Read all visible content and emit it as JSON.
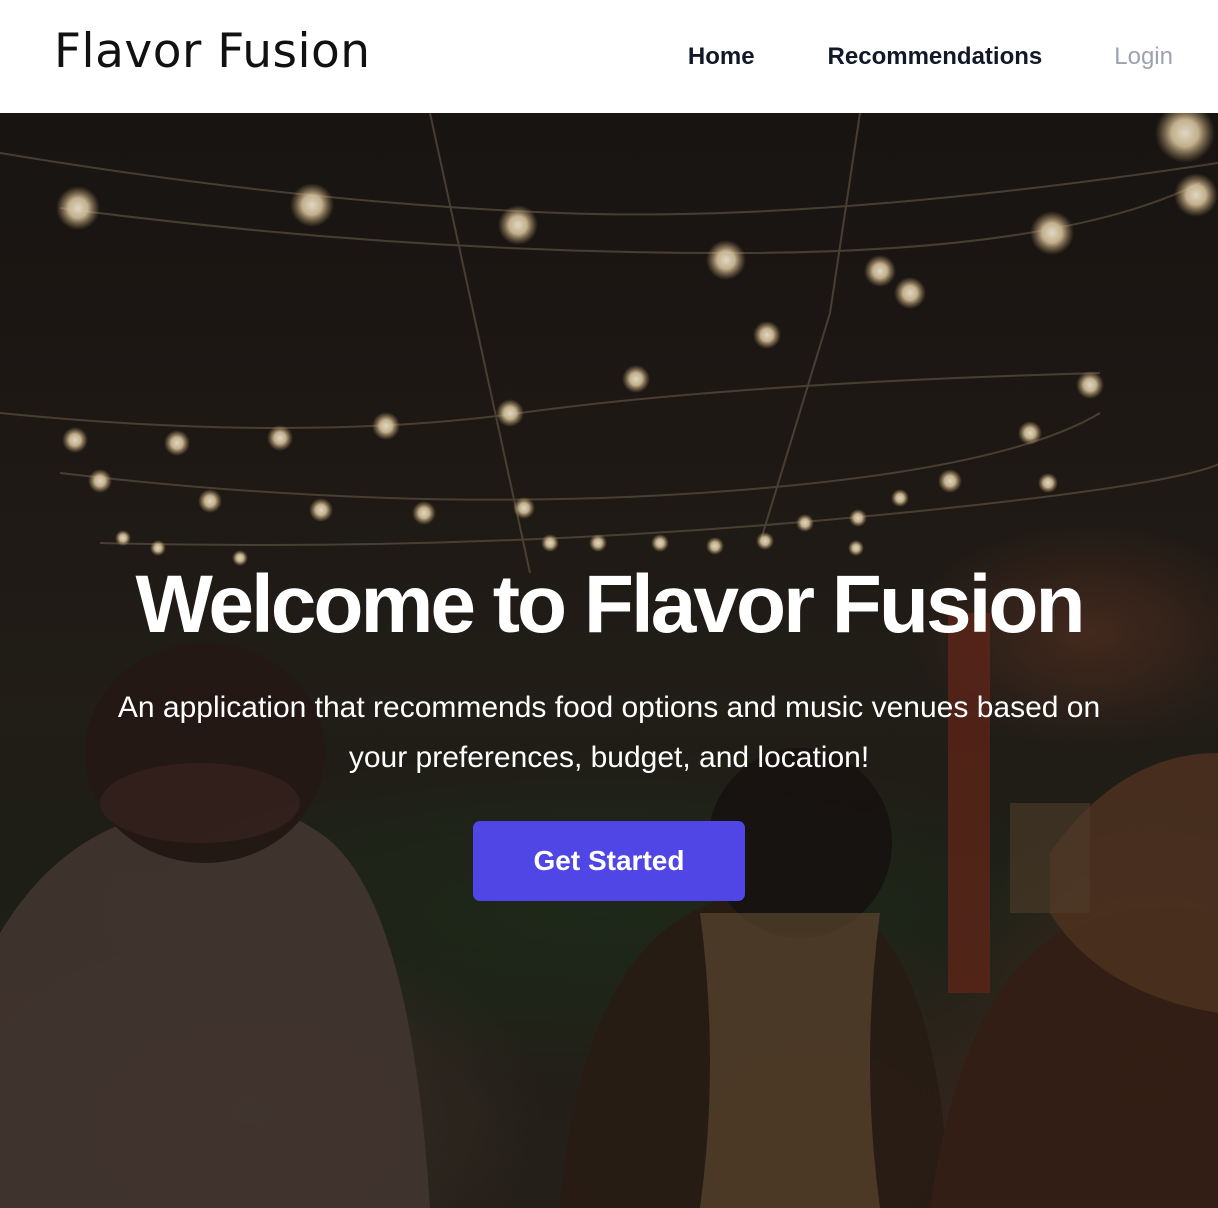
{
  "nav": {
    "brand": "Flavor Fusion",
    "links": [
      {
        "label": "Home"
      },
      {
        "label": "Recommendations"
      },
      {
        "label": "Login"
      }
    ]
  },
  "hero": {
    "title": "Welcome to Flavor Fusion",
    "subtitle": "An application that recommends food options and music venues based on your preferences, budget, and location!",
    "cta_label": "Get Started"
  },
  "colors": {
    "accent": "#4f46e5",
    "nav_text": "#111827",
    "nav_muted": "#9ca3af"
  }
}
